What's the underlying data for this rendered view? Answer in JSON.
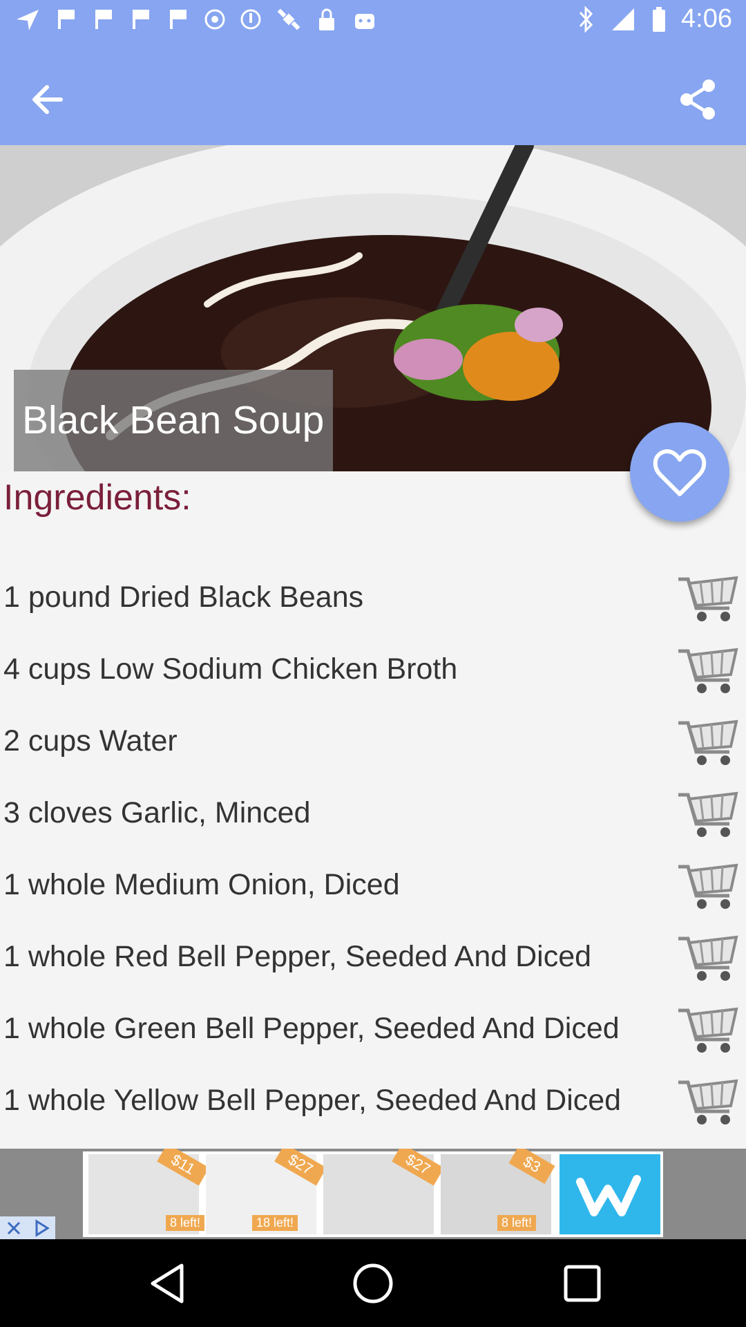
{
  "status_bar": {
    "time": "4:06"
  },
  "toolbar": {
    "back_label": "Back",
    "share_label": "Share"
  },
  "recipe": {
    "title": "Black Bean Soup",
    "ingredients_heading": "Ingredients:"
  },
  "ingredients": [
    "1 pound Dried Black Beans",
    "4 cups Low Sodium Chicken Broth",
    "2 cups Water",
    "3 cloves Garlic, Minced",
    "1 whole Medium Onion, Diced",
    "1 whole Red Bell Pepper, Seeded And Diced",
    "1 whole Green Bell Pepper, Seeded And Diced",
    "1 whole Yellow Bell Pepper, Seeded And Diced"
  ],
  "ad": {
    "tags": [
      "$11",
      "$27",
      "$27",
      "$3"
    ],
    "stock_labels": [
      "8 left!",
      "18 left!",
      "8 left!"
    ]
  },
  "colors": {
    "accent": "#87a5f0",
    "heading": "#7a1f3a"
  },
  "icons": [
    "back-arrow-icon",
    "share-icon",
    "heart-icon",
    "cart-icon",
    "wish-logo-icon"
  ]
}
